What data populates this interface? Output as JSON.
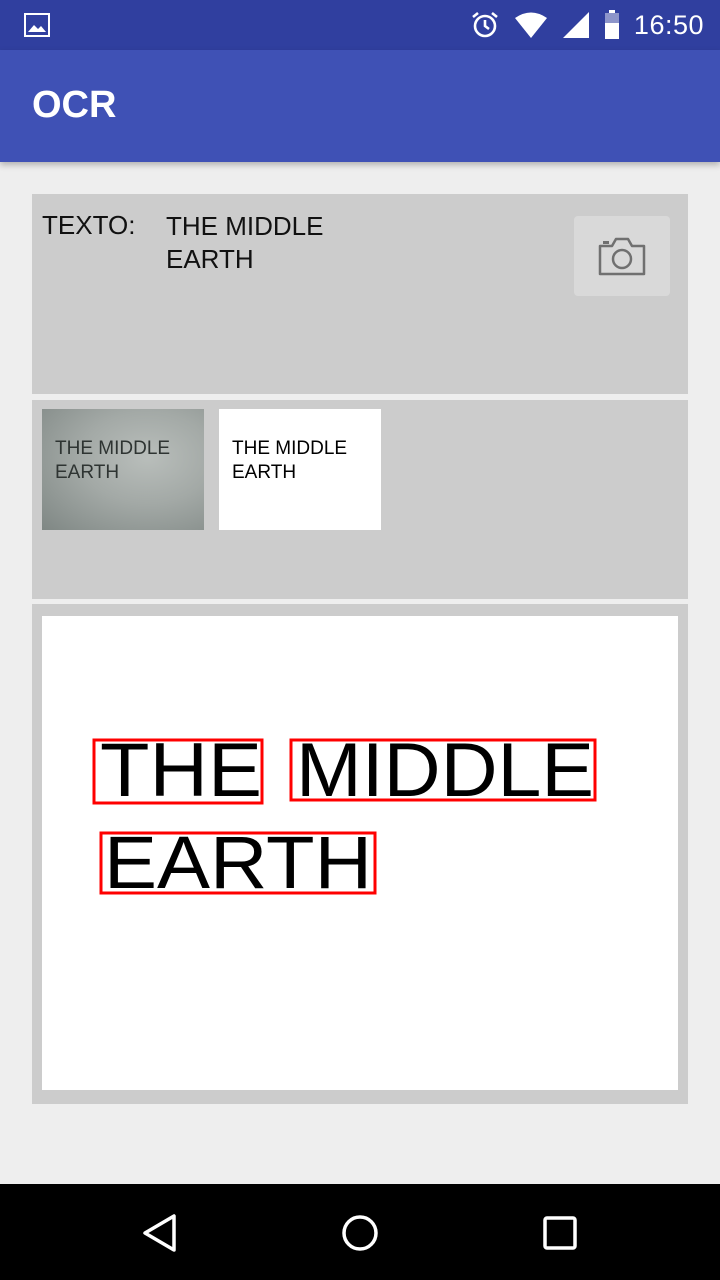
{
  "status_bar": {
    "time": "16:50",
    "icons": [
      "image-notification-icon",
      "alarm-icon",
      "wifi-icon",
      "signal-icon",
      "battery-icon"
    ]
  },
  "app_bar": {
    "title": "OCR"
  },
  "text_panel": {
    "label": "TEXTO:",
    "value": "THE MIDDLE EARTH",
    "camera_button_icon": "camera-icon"
  },
  "thumbnails": {
    "original": {
      "line1": "THE MIDDLE",
      "line2": "EARTH"
    },
    "processed": {
      "line1": "THE MIDDLE",
      "line2": "EARTH"
    }
  },
  "result": {
    "words": [
      "THE",
      "MIDDLE",
      "EARTH"
    ],
    "box_color": "#ff0000"
  },
  "nav_bar": {
    "buttons": [
      "back-icon",
      "home-icon",
      "recents-icon"
    ]
  },
  "colors": {
    "status_bar": "#303f9f",
    "app_bar": "#3f51b5",
    "panel": "#cccccc",
    "background": "#eeeeee"
  }
}
